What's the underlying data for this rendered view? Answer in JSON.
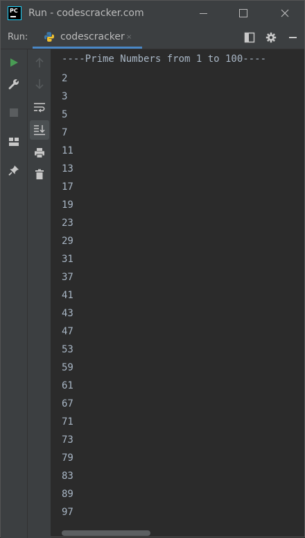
{
  "window": {
    "title": "Run - codescracker.com",
    "app_icon_text": "PC"
  },
  "run_panel": {
    "label": "Run:",
    "tab_name": "codescracker",
    "tab_close": "×"
  },
  "console": {
    "header": "----Prime Numbers from 1 to 100----",
    "lines": [
      "2",
      "3",
      "5",
      "7",
      "11",
      "13",
      "17",
      "19",
      "23",
      "29",
      "31",
      "37",
      "41",
      "43",
      "47",
      "53",
      "59",
      "61",
      "67",
      "71",
      "73",
      "79",
      "83",
      "89",
      "97"
    ]
  },
  "colors": {
    "background": "#2b2b2b",
    "toolbar": "#3c3f41",
    "text": "#a9b7c6",
    "run_green": "#499c54",
    "tab_underline": "#4a88c7"
  }
}
